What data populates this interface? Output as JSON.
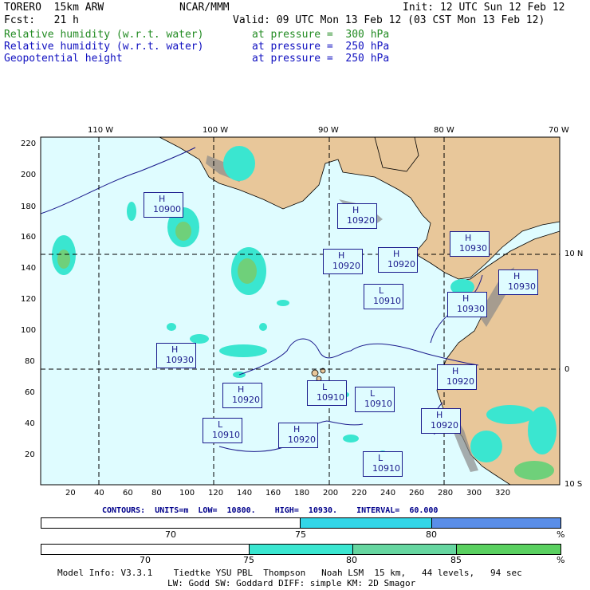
{
  "header": {
    "model": "TORERO  15km ARW",
    "institution": "NCAR/MMM",
    "init": "Init: 12 UTC Sun 12 Feb 12",
    "fcst": "Fcst:   21 h",
    "valid": "Valid: 09 UTC Mon 13 Feb 12 (03 CST Mon 13 Feb 12)"
  },
  "fields": [
    {
      "name": "Relative humidity (w.r.t. water)",
      "level": "at pressure =  300 hPa",
      "color": "#228b22"
    },
    {
      "name": "Relative humidity (w.r.t. water)",
      "level": "at pressure =  250 hPa",
      "color": "#1010c0"
    },
    {
      "name": "Geopotential height",
      "level": "at pressure =  250 hPa",
      "color": "#1010c0"
    }
  ],
  "map": {
    "lon_labels": [
      "110 W",
      "100 W",
      "90 W",
      "80 W",
      "70 W"
    ],
    "lat_labels": [
      "10 N",
      "0",
      "10 S"
    ],
    "y_ticks": [
      "220",
      "200",
      "180",
      "160",
      "140",
      "120",
      "100",
      "80",
      "60",
      "40",
      "20"
    ],
    "x_ticks": [
      "20",
      "40",
      "60",
      "80",
      "100",
      "120",
      "140",
      "160",
      "180",
      "200",
      "220",
      "240",
      "260",
      "280",
      "300",
      "320"
    ],
    "colors": {
      "ocean": "#dffcff",
      "land": "#e8c79a",
      "mountain": "#8a8a8a",
      "rh_cyan": "#3ae6d0",
      "rh_green": "#6fd07a",
      "contour": "#1a1a8c"
    },
    "pressure_systems": [
      {
        "type": "H",
        "value": "10900"
      },
      {
        "type": "H",
        "value": "10920"
      },
      {
        "type": "H",
        "value": "10930"
      },
      {
        "type": "H",
        "value": "10920"
      },
      {
        "type": "H",
        "value": "10920"
      },
      {
        "type": "L",
        "value": "10910"
      },
      {
        "type": "H",
        "value": "10930"
      },
      {
        "type": "H",
        "value": "10930"
      },
      {
        "type": "H",
        "value": "10930"
      },
      {
        "type": "H",
        "value": "10920"
      },
      {
        "type": "H",
        "value": "10920"
      },
      {
        "type": "L",
        "value": "10910"
      },
      {
        "type": "H",
        "value": "10920"
      },
      {
        "type": "L",
        "value": "10910"
      },
      {
        "type": "L",
        "value": "10910"
      },
      {
        "type": "H",
        "value": "10920"
      },
      {
        "type": "L",
        "value": "10910"
      }
    ]
  },
  "contours_info": "CONTOURS:  UNITS=m  LOW=  10800.    HIGH=  10930.    INTERVAL=  60.000",
  "colorbar_250": {
    "colors": [
      "#ffffff",
      "#33d6e8",
      "#5a8ee8"
    ],
    "labels": [
      "70",
      "75",
      "80"
    ],
    "unit": "%"
  },
  "colorbar_300": {
    "colors": [
      "#ffffff",
      "#3ae6d0",
      "#66d6a0",
      "#5ad060"
    ],
    "labels": [
      "70",
      "75",
      "80",
      "85"
    ],
    "unit": "%"
  },
  "footer": {
    "line1": "Model Info: V3.3.1    Tiedtke YSU PBL  Thompson   Noah LSM  15 km,   44 levels,   94 sec",
    "line2": "LW: Godd SW: Goddard DIFF: simple KM: 2D Smagor"
  }
}
